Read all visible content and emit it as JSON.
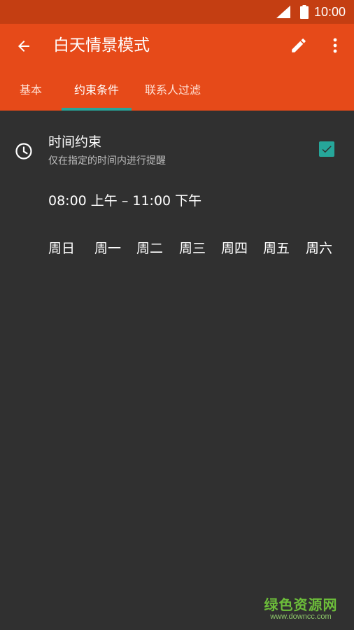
{
  "status_bar": {
    "time": "10:00"
  },
  "app_bar": {
    "title": "白天情景模式",
    "back_icon": "arrow-back-icon",
    "edit_icon": "pencil-icon",
    "more_icon": "more-vert-icon",
    "color": "#e64a19"
  },
  "tabs": [
    {
      "label": "基本",
      "active": false
    },
    {
      "label": "约束条件",
      "active": true
    },
    {
      "label": "联系人过滤",
      "active": false
    }
  ],
  "constraint": {
    "title": "时间约束",
    "subtitle": "仅在指定的时间内进行提醒",
    "checked": true,
    "time_range": "08:00 上午 – 11:00 下午",
    "days": [
      "周日",
      "周一",
      "周二",
      "周三",
      "周四",
      "周五",
      "周六"
    ]
  },
  "watermark": {
    "main": "绿色资源网",
    "sub": "www.downcc.com"
  },
  "colors": {
    "accent": "#26a69a",
    "status_bar": "#c43e12",
    "background": "#303030"
  }
}
